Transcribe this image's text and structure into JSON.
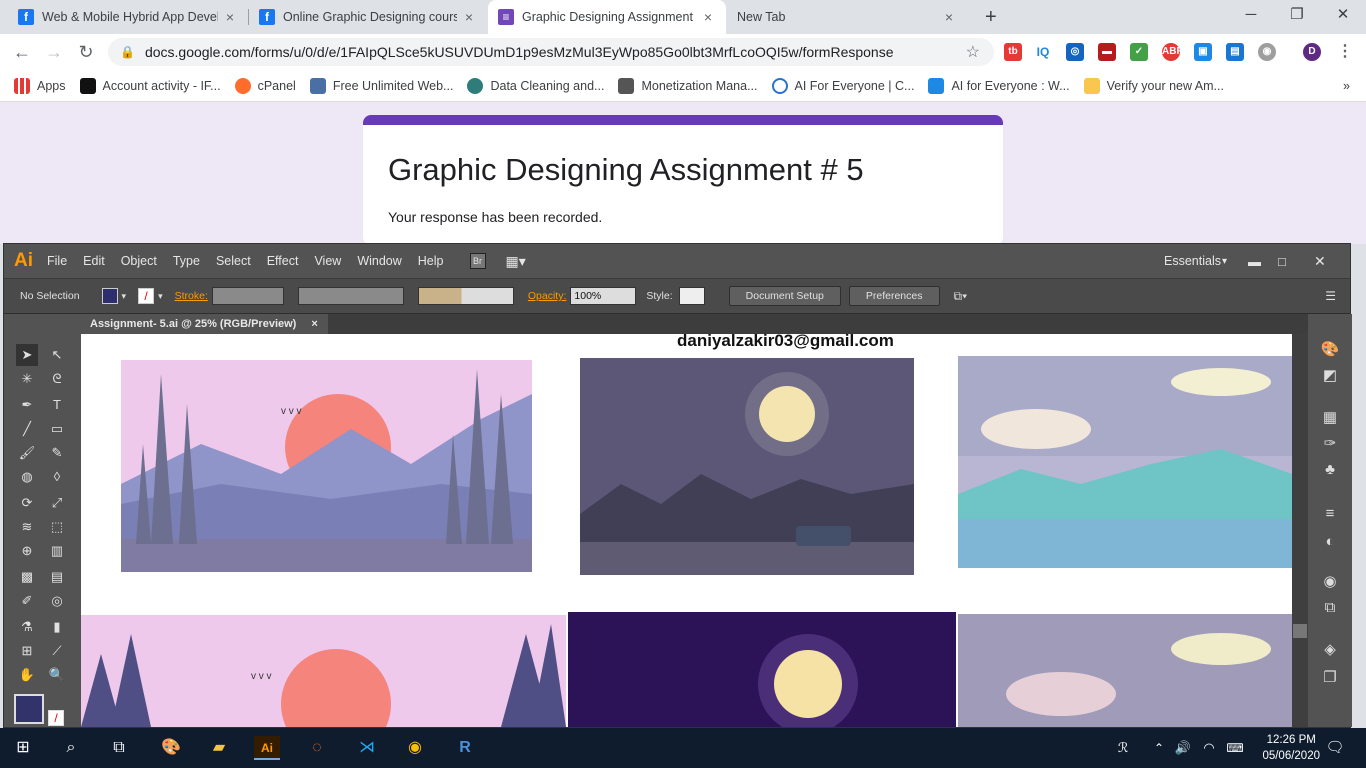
{
  "tabs": [
    {
      "label": "Web & Mobile Hybrid App Devel",
      "icon": "facebook-icon"
    },
    {
      "label": "Online Graphic Designing course",
      "icon": "facebook-icon"
    },
    {
      "label": "Graphic Designing Assignment #",
      "icon": "google-forms-icon"
    },
    {
      "label": "New Tab",
      "icon": ""
    }
  ],
  "new_tab_symbol": "+",
  "url": "docs.google.com/forms/u/0/d/e/1FAIpQLSce5kUSUVDUmD1p9esMzMul3EyWpo85Go0lbt3MrfLcoOQI5w/formResponse",
  "bookmarks": [
    "Apps",
    "Account activity - IF...",
    "cPanel",
    "Free Unlimited Web...",
    "Data Cleaning and...",
    "Monetization Mana...",
    "AI For Everyone | C...",
    "AI for Everyone : W...",
    "Verify your new Am..."
  ],
  "bookmarks_more": "»",
  "form": {
    "title": "Graphic Designing Assignment # 5",
    "message": "Your response has been recorded."
  },
  "illustrator": {
    "logo": "Ai",
    "menu": [
      "File",
      "Edit",
      "Object",
      "Type",
      "Select",
      "Effect",
      "View",
      "Window",
      "Help"
    ],
    "bridge_label": "Br",
    "workspace": "Essentials",
    "control": {
      "selection": "No Selection",
      "stroke_label": "Stroke:",
      "opacity_label": "Opacity:",
      "opacity_value": "100%",
      "style_label": "Style:",
      "document_setup": "Document Setup",
      "preferences": "Preferences"
    },
    "doc_tab": "Assignment- 5.ai @ 25% (RGB/Preview)",
    "doc_tab_close": "×",
    "artboard_text": "daniyalzakir03@gmail.com"
  },
  "taskbar": {
    "time": "12:26 PM",
    "date": "05/06/2020"
  },
  "colors": {
    "chrome_bg": "#dee1e6",
    "forms_purple": "#673ab7",
    "forms_bg": "#ede7f6",
    "ai_panel": "#535353",
    "ai_orange": "#ff9a00",
    "taskbar": "#0f1c2e"
  }
}
